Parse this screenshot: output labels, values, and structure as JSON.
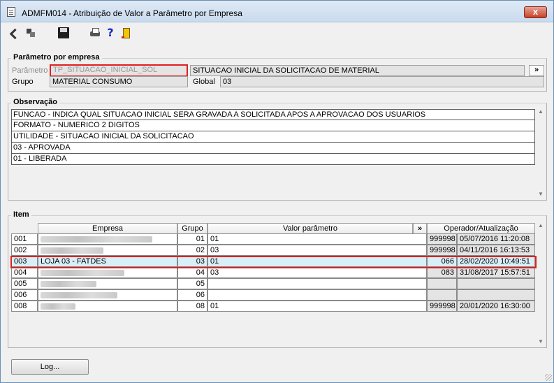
{
  "window": {
    "title": "ADMFM014 - Atribuição de Valor a Parâmetro por Empresa",
    "close_glyph": "x"
  },
  "toolbar": {
    "help_glyph": "?"
  },
  "parametro": {
    "section_title": "Parâmetro por empresa",
    "param_label": "Parâmetro",
    "param_value": "TP_SITUACAO_INICIAL_SOL",
    "param_desc": "SITUACAO INICIAL DA SOLICITACAO DE MATERIAL",
    "more_label": "»",
    "grupo_label": "Grupo",
    "grupo_value": "MATERIAL CONSUMO",
    "global_label": "Global",
    "global_value": "03"
  },
  "observacao": {
    "section_title": "Observação",
    "lines": [
      "FUNCAO - INDICA QUAL SITUACAO INICIAL SERA GRAVADA A SOLICITADA APOS A APROVACAO DOS USUARIOS",
      "FORMATO - NUMERICO 2 DIGITOS",
      "UTILIDADE - SITUACAO INICIAL DA SOLICITACAO",
      "03 - APROVADA",
      "01 - LIBERADA"
    ]
  },
  "item": {
    "section_title": "Item",
    "columns": {
      "empresa": "Empresa",
      "grupo": "Grupo",
      "valor": "Valor parâmetro",
      "more": "»",
      "operador": "Operador/Atualização"
    },
    "rows": [
      {
        "code": "001",
        "empresa": "",
        "grupo": "01",
        "valor": "01",
        "operador": "999998",
        "data": "05/07/2016 11:20:08"
      },
      {
        "code": "002",
        "empresa": "",
        "grupo": "02",
        "valor": "03",
        "operador": "999998",
        "data": "04/11/2016 16:13:53"
      },
      {
        "code": "003",
        "empresa": "LOJA 03 - FATDES",
        "grupo": "03",
        "valor": "01",
        "operador": "066",
        "data": "28/02/2020 10:49:51"
      },
      {
        "code": "004",
        "empresa": "",
        "grupo": "04",
        "valor": "03",
        "operador": "083",
        "data": "31/08/2017 15:57:51"
      },
      {
        "code": "005",
        "empresa": "",
        "grupo": "05",
        "valor": "",
        "operador": "",
        "data": ""
      },
      {
        "code": "006",
        "empresa": "",
        "grupo": "06",
        "valor": "",
        "operador": "",
        "data": ""
      },
      {
        "code": "008",
        "empresa": "",
        "grupo": "08",
        "valor": "01",
        "operador": "999998",
        "data": "20/01/2020 16:30:00"
      }
    ]
  },
  "footer": {
    "log_button": "Log..."
  }
}
